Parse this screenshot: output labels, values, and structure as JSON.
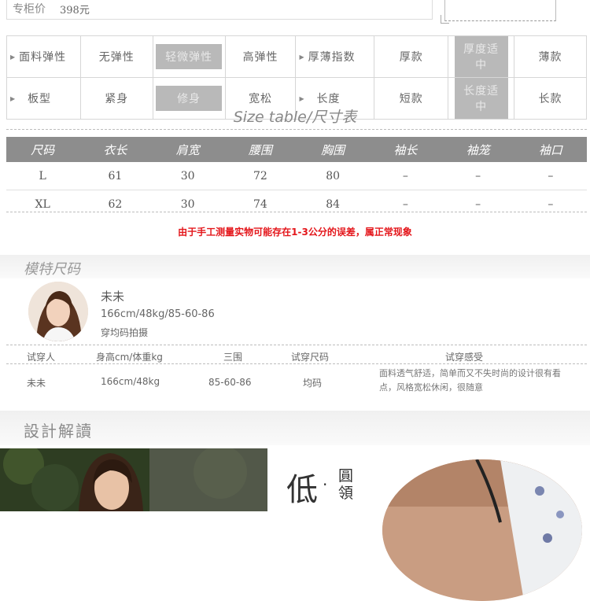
{
  "price": {
    "label": "专柜价",
    "value": "398元"
  },
  "attributes": {
    "rows": [
      {
        "head": "面料弹性",
        "options": [
          "无弹性",
          "轻微弹性",
          "高弹性"
        ],
        "selected": 1,
        "head2": "厚薄指数",
        "options2": [
          "厚款",
          "厚度适中",
          "薄款"
        ],
        "selected2": 1
      },
      {
        "head": "板型",
        "options": [
          "紧身",
          "修身",
          "宽松"
        ],
        "selected": 1,
        "head2": "长度",
        "options2": [
          "短款",
          "长度适中",
          "长款"
        ],
        "selected2": 1
      }
    ]
  },
  "size_table": {
    "title": "Size table/尺寸表",
    "headers": [
      "尺码",
      "衣长",
      "肩宽",
      "腰围",
      "胸围",
      "袖长",
      "袖笼",
      "袖口"
    ],
    "rows": [
      [
        "L",
        "61",
        "30",
        "72",
        "80",
        "–",
        "–",
        "–"
      ],
      [
        "XL",
        "62",
        "30",
        "74",
        "84",
        "–",
        "–",
        "–"
      ]
    ],
    "note": "由于手工测量实物可能存在1-3公分的误差，属正常现象"
  },
  "model": {
    "section_title": "模特尺码",
    "name": "未未",
    "stats": "166cm/48kg/85-60-86",
    "wear_note": "穿均码拍摄",
    "fit_headers": [
      "试穿人",
      "身高cm/体重kg",
      "三围",
      "试穿尺码",
      "试穿感受"
    ],
    "fit_row": {
      "person": "未未",
      "height_weight": "166cm/48kg",
      "measurements": "85-60-86",
      "size": "均码",
      "feeling": "面料透气舒适，简单而又不失时尚的设计很有看点，风格宽松休闲，很随意"
    }
  },
  "design": {
    "section_title": "設計解讀",
    "low_char": "低",
    "dot": "·",
    "vertical_text": "圓領"
  },
  "colors": {
    "table_header": "#8d8d8d",
    "selected_chip": "#b9b9b9",
    "note": "#e4161b"
  }
}
